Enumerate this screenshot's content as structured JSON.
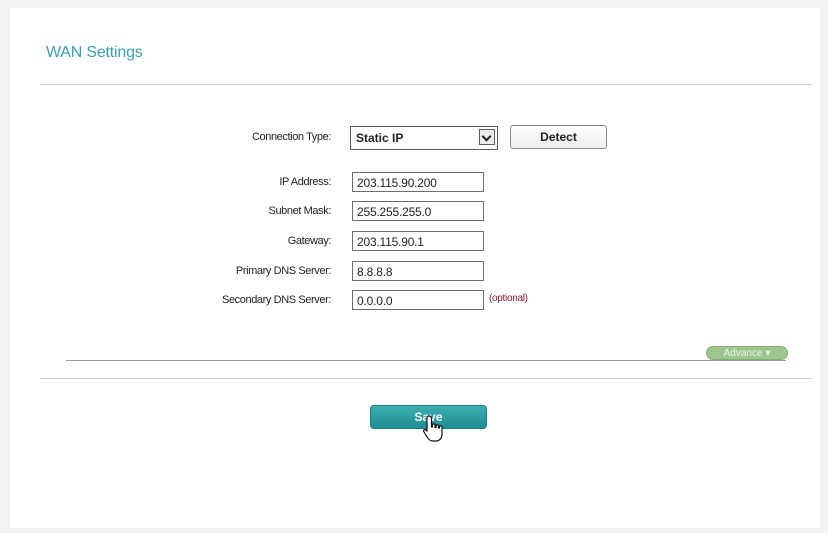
{
  "page": {
    "title": "WAN Settings",
    "accent_color": "#3aa0ad"
  },
  "form": {
    "connection_type": {
      "label": "Connection Type:",
      "selected": "Static IP"
    },
    "detect_label": "Detect",
    "fields": [
      {
        "label": "IP Address:",
        "value": "203.115.90.200"
      },
      {
        "label": "Subnet Mask:",
        "value": "255.255.255.0"
      },
      {
        "label": "Gateway:",
        "value": "203.115.90.1"
      },
      {
        "label": "Primary DNS Server:",
        "value": "8.8.8.8"
      },
      {
        "label": "Secondary DNS Server:",
        "value": "0.0.0.0"
      }
    ],
    "optional_note": "(optional)"
  },
  "advance": {
    "label": "Advance",
    "icon": "chevron-down-icon"
  },
  "save": {
    "label": "Save",
    "cursor_icon": "hand-pointer-icon"
  }
}
